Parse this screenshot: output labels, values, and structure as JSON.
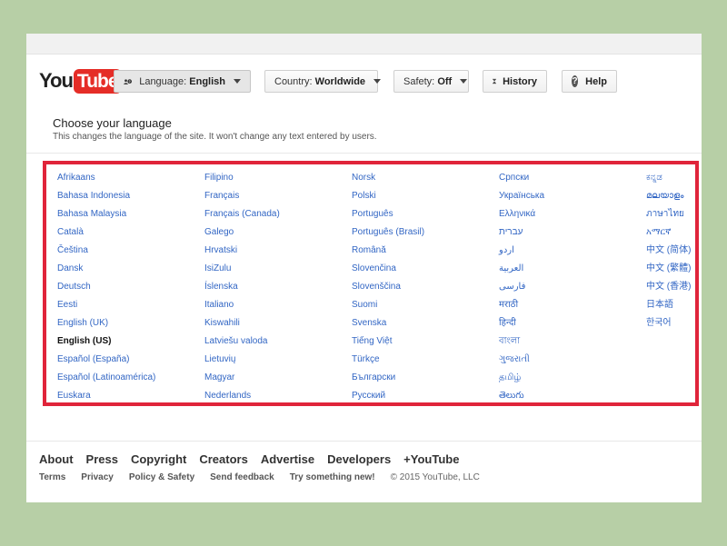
{
  "header": {
    "logo_you": "You",
    "logo_tube": "Tube",
    "language_label": "Language:",
    "language_value": "English",
    "country_label": "Country:",
    "country_value": "Worldwide",
    "safety_label": "Safety:",
    "safety_value": "Off",
    "history_label": "History",
    "help_label": "Help",
    "help_glyph": "?"
  },
  "section": {
    "title": "Choose your language",
    "subtitle": "This changes the language of the site. It won't change any text entered by users."
  },
  "languages": {
    "selected": "English (US)",
    "columns": [
      [
        "Afrikaans",
        "Bahasa Indonesia",
        "Bahasa Malaysia",
        "Català",
        "Čeština",
        "Dansk",
        "Deutsch",
        "Eesti",
        "English (UK)",
        "English (US)",
        "Español (España)",
        "Español (Latinoamérica)",
        "Euskara"
      ],
      [
        "Filipino",
        "Français",
        "Français (Canada)",
        "Galego",
        "Hrvatski",
        "IsiZulu",
        "Íslenska",
        "Italiano",
        "Kiswahili",
        "Latviešu valoda",
        "Lietuvių",
        "Magyar",
        "Nederlands"
      ],
      [
        "Norsk",
        "Polski",
        "Português",
        "Português (Brasil)",
        "Română",
        "Slovenčina",
        "Slovenščina",
        "Suomi",
        "Svenska",
        "Tiếng Việt",
        "Türkçe",
        "Български",
        "Русский"
      ],
      [
        "Српски",
        "Українська",
        "Ελληνικά",
        "עברית",
        "اردو",
        "العربية",
        "فارسی",
        "मराठी",
        "हिन्दी",
        "বাংলা",
        "ગુજરાતી",
        "தமிழ்",
        "తెలుగు"
      ],
      [
        "ಕನ್ನಡ",
        "മലയാളം",
        "ภาษาไทย",
        "አማርኛ",
        "中文 (简体)",
        "中文 (繁體)",
        "中文 (香港)",
        "日本語",
        "한국어"
      ]
    ]
  },
  "footer": {
    "main": [
      "About",
      "Press",
      "Copyright",
      "Creators",
      "Advertise",
      "Developers",
      "+YouTube"
    ],
    "sub": [
      "Terms",
      "Privacy",
      "Policy & Safety",
      "Send feedback",
      "Try something new!"
    ],
    "copyright": "© 2015 YouTube, LLC"
  },
  "colors": {
    "accent_red": "#e0243a",
    "link_blue": "#3266c4",
    "background_green": "#b7cfa6"
  }
}
